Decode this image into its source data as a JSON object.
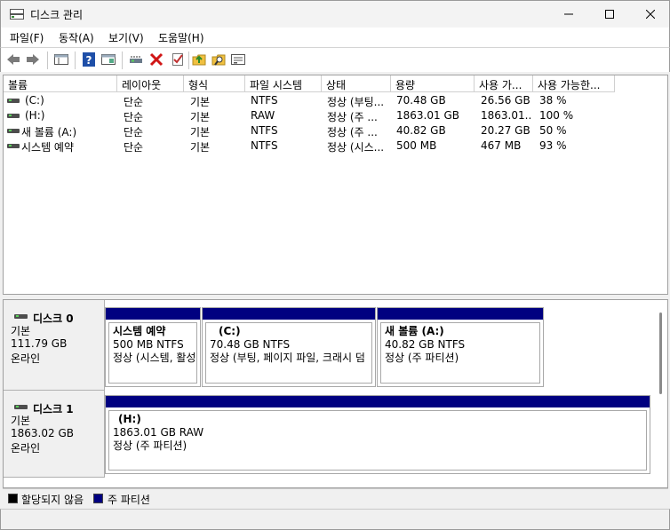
{
  "window": {
    "title": "디스크 관리"
  },
  "menu": [
    "파일(F)",
    "동작(A)",
    "보기(V)",
    "도움말(H)"
  ],
  "toolbar": [
    "back-arrow-icon",
    "forward-arrow-icon",
    "properties-pane-icon",
    "help-icon",
    "console-tree-icon",
    "connect-drive-icon",
    "delete-icon",
    "check-icon",
    "open-folder-icon",
    "search-folder-icon",
    "settings-list-icon"
  ],
  "volumes": {
    "columns": [
      "볼륨",
      "레이아웃",
      "형식",
      "파일 시스템",
      "상태",
      "용량",
      "사용 가...",
      "사용 가능한..."
    ],
    "rows": [
      [
        "(C:)",
        "단순",
        "기본",
        "NTFS",
        "정상 (부팅...",
        "70.48 GB",
        "26.56 GB",
        "38 %"
      ],
      [
        "(H:)",
        "단순",
        "기본",
        "RAW",
        "정상 (주 ...",
        "1863.01 GB",
        "1863.01...",
        "100 %"
      ],
      [
        "새 볼륨 (A:)",
        "단순",
        "기본",
        "NTFS",
        "정상 (주 ...",
        "40.82 GB",
        "20.27 GB",
        "50 %"
      ],
      [
        "시스템 예약",
        "단순",
        "기본",
        "NTFS",
        "정상 (시스...",
        "500 MB",
        "467 MB",
        "93 %"
      ]
    ]
  },
  "disks": [
    {
      "name": "디스크 0",
      "type": "기본",
      "size": "111.79 GB",
      "status": "온라인",
      "partitions": [
        {
          "name": "시스템 예약",
          "size": "500 MB NTFS",
          "status": "정상 (시스템, 활성"
        },
        {
          "name": "(C:)",
          "size": "70.48 GB NTFS",
          "status": "정상 (부팅, 페이지 파일, 크래시 덤"
        },
        {
          "name": "새 볼륨  (A:)",
          "size": "40.82 GB NTFS",
          "status": "정상 (주 파티션)"
        }
      ]
    },
    {
      "name": "디스크 1",
      "type": "기본",
      "size": "1863.02 GB",
      "status": "온라인",
      "partitions": [
        {
          "name": "(H:)",
          "size": "1863.01 GB RAW",
          "status": "정상 (주 파티션)"
        }
      ]
    }
  ],
  "legend": [
    {
      "label": "할당되지 않음",
      "color": "#000000"
    },
    {
      "label": "주 파티션",
      "color": "#000080"
    }
  ]
}
